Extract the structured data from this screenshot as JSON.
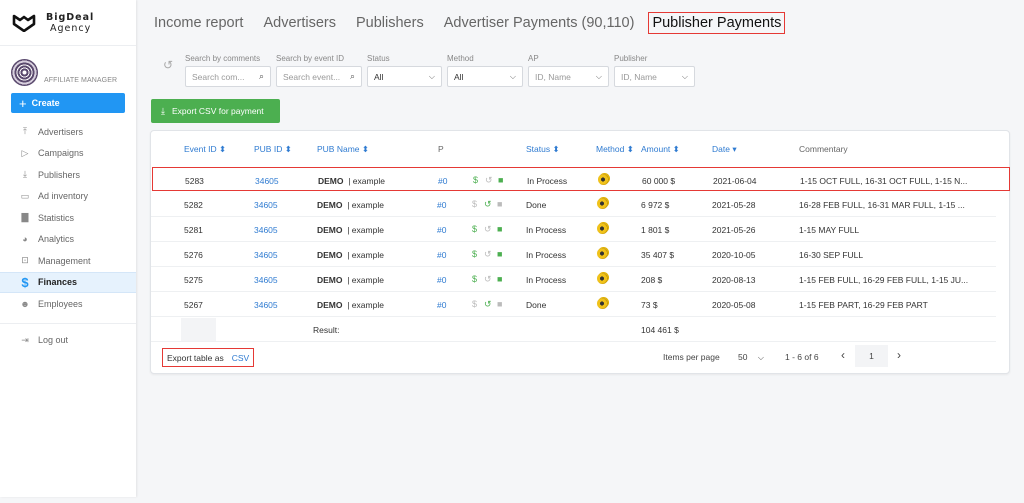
{
  "brand": {
    "line1": "BigDeal",
    "line2": "Agency"
  },
  "profile": {
    "role": "AFFILIATE MANAGER"
  },
  "sidebar": {
    "create_label": "Create",
    "items": [
      {
        "label": "Advertisers",
        "icon": "upload-icon"
      },
      {
        "label": "Campaigns",
        "icon": "play-circle-icon"
      },
      {
        "label": "Publishers",
        "icon": "download-icon"
      },
      {
        "label": "Ad inventory",
        "icon": "window-icon"
      },
      {
        "label": "Statistics",
        "icon": "bar-chart-icon"
      },
      {
        "label": "Analytics",
        "icon": "pie-chart-icon"
      },
      {
        "label": "Management",
        "icon": "settings-box-icon"
      },
      {
        "label": "Finances",
        "icon": "dollar-icon",
        "active": true
      },
      {
        "label": "Employees",
        "icon": "people-icon"
      }
    ],
    "logout_label": "Log out"
  },
  "tabs": [
    {
      "label": "Income report"
    },
    {
      "label": "Advertisers"
    },
    {
      "label": "Publishers"
    },
    {
      "label": "Advertiser Payments (90,110)"
    },
    {
      "label": "Publisher Payments",
      "active": true
    }
  ],
  "filters": {
    "comments": {
      "label": "Search by comments",
      "placeholder": "Search com..."
    },
    "event_id": {
      "label": "Search by event ID",
      "placeholder": "Search event..."
    },
    "status": {
      "label": "Status",
      "value": "All"
    },
    "method": {
      "label": "Method",
      "value": "All"
    },
    "ap": {
      "label": "AP",
      "placeholder": "ID, Name"
    },
    "publisher": {
      "label": "Publisher",
      "placeholder": "ID, Name"
    }
  },
  "export_payment_label": "Export CSV for payment",
  "table": {
    "columns": {
      "event_id": "Event ID ⬍",
      "pub_id": "PUB ID ⬍",
      "pub_name": "PUB Name ⬍",
      "p": "P",
      "status": "Status ⬍",
      "method": "Method ⬍",
      "amount": "Amount ⬍",
      "date": "Date ▾",
      "commentary": "Commentary"
    },
    "rows": [
      {
        "event_id": "5283",
        "pub_id": "34605",
        "pub_name": "DEMO",
        "pub_sub": "| example",
        "p": "#0",
        "pay_enabled": true,
        "revert_enabled": false,
        "delete_enabled": true,
        "status": "In Process",
        "amount": "60 000 $",
        "date": "2021-06-04",
        "commentary": "1-15 OCT FULL, 16-31 OCT FULL, 1-15 N...",
        "highlighted": true
      },
      {
        "event_id": "5282",
        "pub_id": "34605",
        "pub_name": "DEMO",
        "pub_sub": "| example",
        "p": "#0",
        "pay_enabled": false,
        "revert_enabled": true,
        "delete_enabled": false,
        "status": "Done",
        "amount": "6 972 $",
        "date": "2021-05-28",
        "commentary": "16-28 FEB FULL, 16-31 MAR FULL, 1-15 ..."
      },
      {
        "event_id": "5281",
        "pub_id": "34605",
        "pub_name": "DEMO",
        "pub_sub": "| example",
        "p": "#0",
        "pay_enabled": true,
        "revert_enabled": false,
        "delete_enabled": true,
        "status": "In Process",
        "amount": "1 801 $",
        "date": "2021-05-26",
        "commentary": "1-15 MAY FULL"
      },
      {
        "event_id": "5276",
        "pub_id": "34605",
        "pub_name": "DEMO",
        "pub_sub": "| example",
        "p": "#0",
        "pay_enabled": true,
        "revert_enabled": false,
        "delete_enabled": true,
        "status": "In Process",
        "amount": "35 407 $",
        "date": "2020-10-05",
        "commentary": "16-30 SEP FULL"
      },
      {
        "event_id": "5275",
        "pub_id": "34605",
        "pub_name": "DEMO",
        "pub_sub": "| example",
        "p": "#0",
        "pay_enabled": true,
        "revert_enabled": false,
        "delete_enabled": true,
        "status": "In Process",
        "amount": "208 $",
        "date": "2020-08-13",
        "commentary": "1-15 FEB FULL, 16-29 FEB FULL, 1-15 JU..."
      },
      {
        "event_id": "5267",
        "pub_id": "34605",
        "pub_name": "DEMO",
        "pub_sub": "| example",
        "p": "#0",
        "pay_enabled": false,
        "revert_enabled": true,
        "delete_enabled": false,
        "status": "Done",
        "amount": "73 $",
        "date": "2020-05-08",
        "commentary": "1-15 FEB PART, 16-29 FEB PART"
      }
    ],
    "result_label": "Result:",
    "result_total": "104 461 $"
  },
  "footer": {
    "export_label": "Export table as",
    "export_format": "CSV",
    "items_per_page_label": "Items per page",
    "items_per_page": "50",
    "range": "1 - 6 of 6",
    "page": "1"
  },
  "colors": {
    "accent": "#2196f3",
    "link": "#2f7bd1",
    "success": "#4caf50",
    "highlight": "#e53935"
  }
}
